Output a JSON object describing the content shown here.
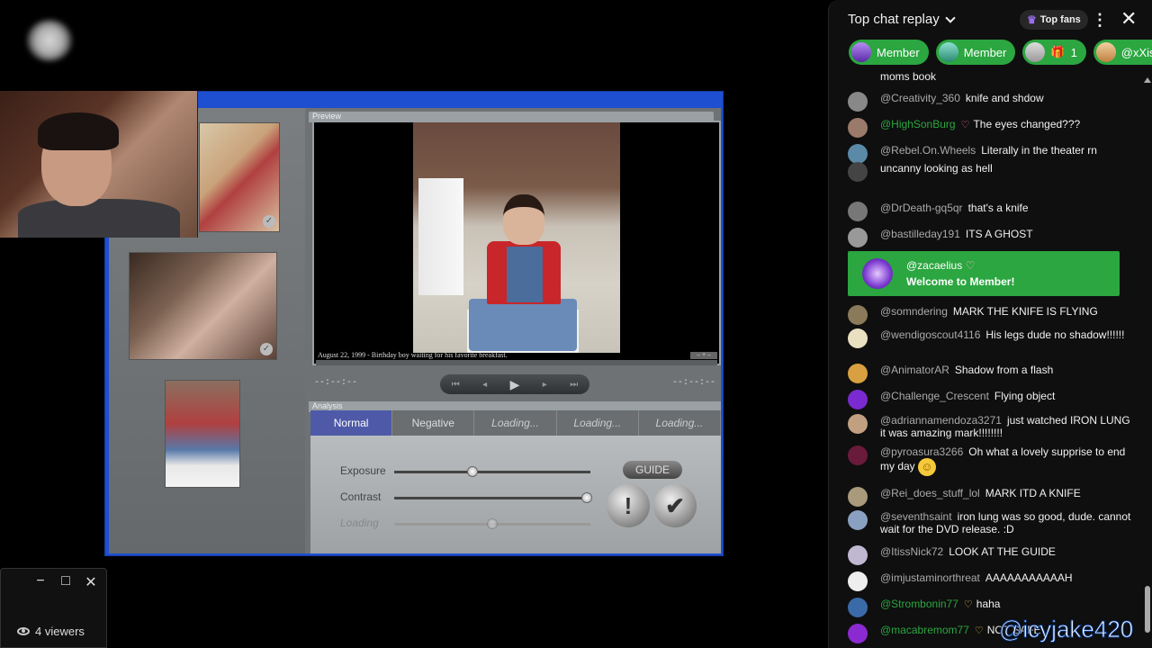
{
  "game": {
    "preview_label": "Preview",
    "analysis_label": "Analysis",
    "caption": "August 22, 1999 - Birthday boy waiting for his favorite breakfast.",
    "time_left": "--:--:--",
    "time_right": "--:--:--",
    "tabs": [
      {
        "label": "Normal",
        "active": true
      },
      {
        "label": "Negative",
        "active": false
      },
      {
        "label": "Loading...",
        "active": false
      },
      {
        "label": "Loading...",
        "active": false
      },
      {
        "label": "Loading...",
        "active": false
      }
    ],
    "sliders": [
      {
        "label": "Exposure",
        "value": 0.4
      },
      {
        "label": "Contrast",
        "value": 0.98
      },
      {
        "label": "Loading",
        "value": 0.5
      }
    ],
    "guide_label": "GUIDE",
    "warn_symbol": "!",
    "confirm_symbol": "✔"
  },
  "viewers": {
    "count_label": "4 viewers",
    "minimize": "−",
    "maximize": "□",
    "close": "✕"
  },
  "chat": {
    "title": "Top chat replay",
    "top_fans_label": "Top fans",
    "chips": [
      {
        "label": "Member"
      },
      {
        "label": "Member"
      },
      {
        "label": "1"
      },
      {
        "label": "@xXisisIo"
      }
    ],
    "partial_top": "moms book",
    "messages": [
      {
        "author": "@Creativity_360",
        "text": "knife and shdow",
        "member": false,
        "color": "#888",
        "heart": false,
        "gold": false
      },
      {
        "author": "@HighSonBurg",
        "text": "The eyes changed???",
        "member": true,
        "color": "#9a7a6a",
        "heart": true,
        "gold": false
      },
      {
        "author": "@Rebel.On.Wheels",
        "text": "Literally in the theater rn",
        "member": false,
        "color": "#5a8aa8",
        "heart": false,
        "gold": false
      },
      {
        "author": "",
        "text": "uncanny looking as hell",
        "member": false,
        "color": "#444",
        "heart": false,
        "gold": false
      },
      {
        "author": "@DrDeath-gq5qr",
        "text": "that's a knife",
        "member": false,
        "color": "#777",
        "heart": false,
        "gold": false
      },
      {
        "author": "@bastilleday191",
        "text": "ITS A GHOST",
        "member": false,
        "color": "#999",
        "heart": false,
        "gold": false
      },
      {
        "author": "@somndering",
        "text": "MARK THE KNIFE IS FLYING",
        "member": false,
        "color": "#8a7a5a",
        "heart": false,
        "gold": false
      },
      {
        "author": "@wendigoscout4116",
        "text": "His legs dude no shadow!!!!!!",
        "member": false,
        "color": "#e8e0c0",
        "heart": false,
        "gold": false
      },
      {
        "author": "@AnimatorAR",
        "text": "Shadow from a flash",
        "member": false,
        "color": "#d8a040",
        "heart": false,
        "gold": false
      },
      {
        "author": "@Challenge_Crescent",
        "text": "Flying object",
        "member": false,
        "color": "#7a2ad0",
        "heart": false,
        "gold": false
      },
      {
        "author": "@adriannamendoza3271",
        "text": "just watched IRON LUNG it was amazing mark!!!!!!!!",
        "member": false,
        "color": "#c0a080",
        "heart": false,
        "gold": false
      },
      {
        "author": "@pyroasura3266",
        "text": "Oh what a lovely supprise to end my day",
        "member": false,
        "color": "#6a1a3a",
        "heart": false,
        "gold": false,
        "emoji": "☺"
      },
      {
        "author": "@Rei_does_stuff_lol",
        "text": "MARK ITD A KNIFE",
        "member": false,
        "color": "#a89a7a",
        "heart": false,
        "gold": false
      },
      {
        "author": "@seventhsaint",
        "text": "iron lung was so good, dude. cannot wait for the DVD release. :D",
        "member": false,
        "color": "#8aa0c0",
        "heart": false,
        "gold": false
      },
      {
        "author": "@ItissNick72",
        "text": "LOOK AT THE GUIDE",
        "member": false,
        "color": "#c0b8d0",
        "heart": false,
        "gold": false
      },
      {
        "author": "@imjustaminorthreat",
        "text": "AAAAAAAAAAAH",
        "member": false,
        "color": "#eee",
        "heart": false,
        "gold": false
      },
      {
        "author": "@Strombonin77",
        "text": "haha",
        "member": true,
        "color": "#3a6aa8",
        "heart": false,
        "gold": true
      },
      {
        "author": "@macabremom77",
        "text": "NOT SAFE",
        "member": true,
        "color": "#8a2ad0",
        "heart": false,
        "gold": true
      }
    ],
    "welcome": {
      "author": "@zacaelius",
      "text": "Welcome to Member!"
    }
  },
  "watermark": "@icyjake420",
  "colors": {
    "member_green": "#2ba640",
    "game_blue": "#1d4fd0",
    "active_tab": "#4e5aa8"
  }
}
